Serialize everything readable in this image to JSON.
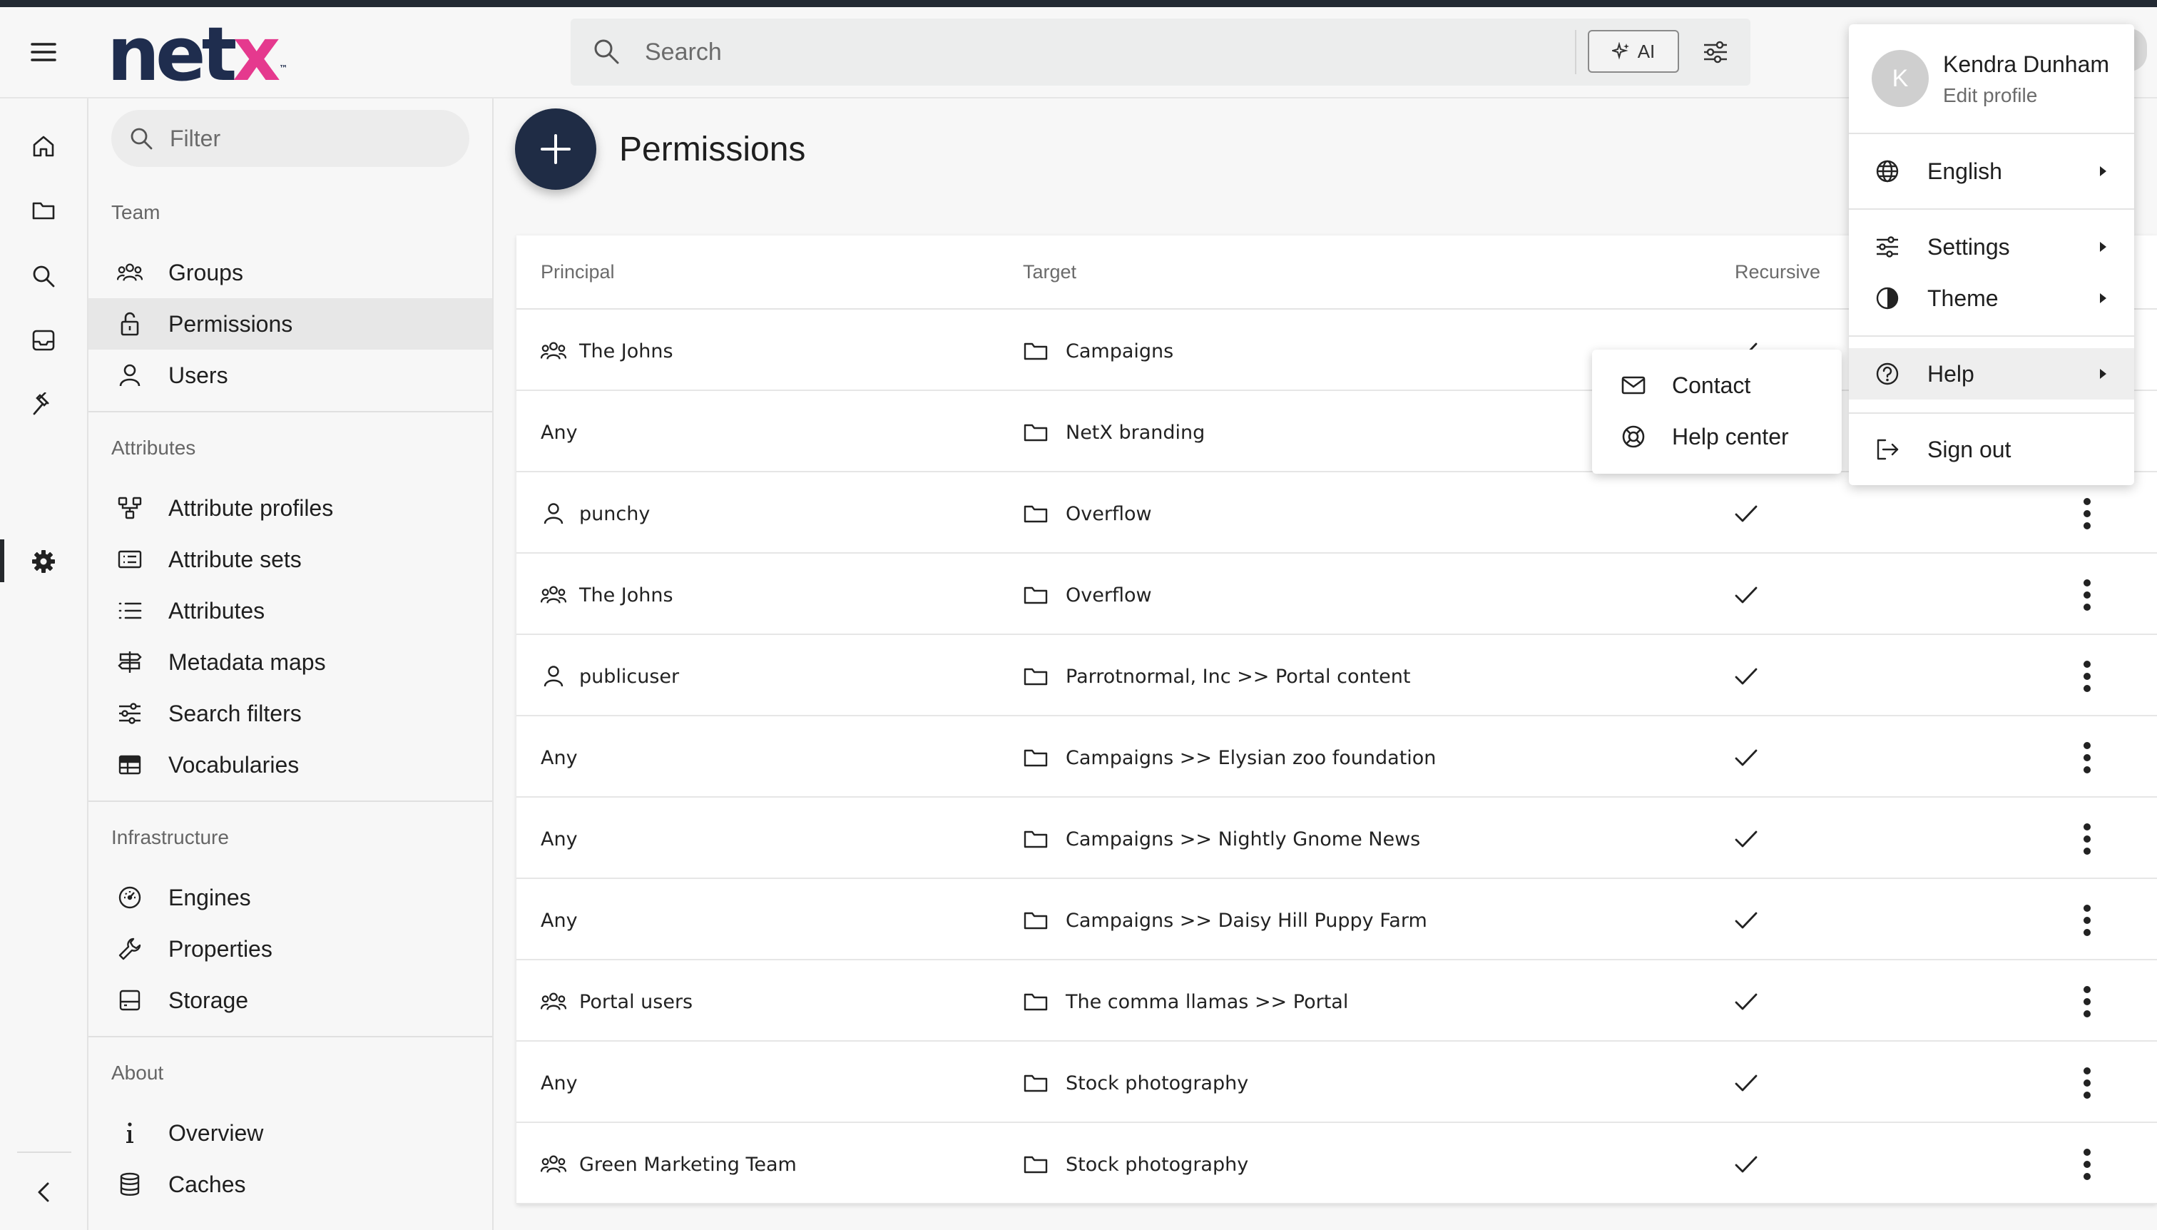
{
  "header": {
    "logo_main": "net",
    "logo_accent": "x",
    "logo_mark": "™",
    "search_placeholder": "Search",
    "ai_label": "AI"
  },
  "sidebar": {
    "filter_placeholder": "Filter",
    "sections": [
      {
        "title": "Team",
        "items": [
          {
            "label": "Groups",
            "icon": "groups-icon"
          },
          {
            "label": "Permissions",
            "icon": "lock-icon",
            "active": true
          },
          {
            "label": "Users",
            "icon": "user-icon"
          }
        ]
      },
      {
        "title": "Attributes",
        "items": [
          {
            "label": "Attribute profiles",
            "icon": "hierarchy-icon"
          },
          {
            "label": "Attribute sets",
            "icon": "card-list-icon"
          },
          {
            "label": "Attributes",
            "icon": "list-icon"
          },
          {
            "label": "Metadata maps",
            "icon": "signpost-icon"
          },
          {
            "label": "Search filters",
            "icon": "sliders-icon"
          },
          {
            "label": "Vocabularies",
            "icon": "table-icon"
          }
        ]
      },
      {
        "title": "Infrastructure",
        "items": [
          {
            "label": "Engines",
            "icon": "gauge-icon"
          },
          {
            "label": "Properties",
            "icon": "wrench-icon"
          },
          {
            "label": "Storage",
            "icon": "storage-icon"
          }
        ]
      },
      {
        "title": "About",
        "items": [
          {
            "label": "Overview",
            "icon": "info-icon"
          },
          {
            "label": "Caches",
            "icon": "database-icon"
          }
        ]
      }
    ]
  },
  "main": {
    "title": "Permissions",
    "columns": {
      "principal": "Principal",
      "target": "Target",
      "recursive": "Recursive"
    },
    "rows": [
      {
        "principal": "The Johns",
        "principal_type": "group",
        "target": "Campaigns",
        "recursive": true
      },
      {
        "principal": "Any",
        "principal_type": "any",
        "target": "NetX branding",
        "recursive": true
      },
      {
        "principal": "punchy",
        "principal_type": "user",
        "target": "Overflow",
        "recursive": true
      },
      {
        "principal": "The Johns",
        "principal_type": "group",
        "target": "Overflow",
        "recursive": true
      },
      {
        "principal": "publicuser",
        "principal_type": "user",
        "target": "Parrotnormal, Inc >> Portal content",
        "recursive": true
      },
      {
        "principal": "Any",
        "principal_type": "any",
        "target": "Campaigns >> Elysian zoo foundation",
        "recursive": true
      },
      {
        "principal": "Any",
        "principal_type": "any",
        "target": "Campaigns >> Nightly Gnome News",
        "recursive": true
      },
      {
        "principal": "Any",
        "principal_type": "any",
        "target": "Campaigns >> Daisy Hill Puppy Farm",
        "recursive": true
      },
      {
        "principal": "Portal users",
        "principal_type": "group",
        "target": "The comma llamas >> Portal",
        "recursive": true
      },
      {
        "principal": "Any",
        "principal_type": "any",
        "target": "Stock photography",
        "recursive": true
      },
      {
        "principal": "Green Marketing Team",
        "principal_type": "group",
        "target": "Stock photography",
        "recursive": true
      }
    ]
  },
  "user_menu": {
    "avatar_letter": "K",
    "name": "Kendra Dunham",
    "edit_profile": "Edit profile",
    "language": "English",
    "settings": "Settings",
    "theme": "Theme",
    "help": "Help",
    "sign_out": "Sign out"
  },
  "help_menu": {
    "contact": "Contact",
    "help_center": "Help center"
  },
  "colors": {
    "brand_navy": "#1f2d4e",
    "brand_pink": "#e5398e",
    "fab": "#1f2c45"
  }
}
